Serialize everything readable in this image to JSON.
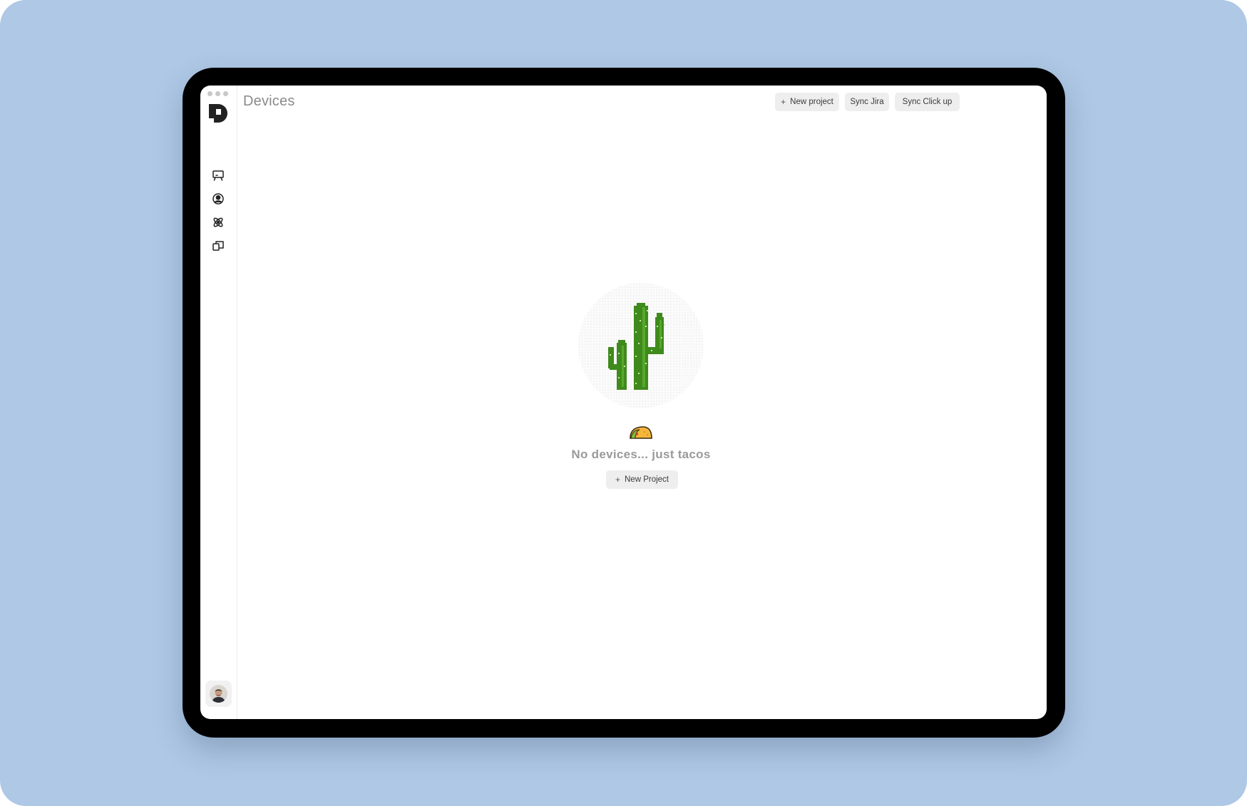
{
  "header": {
    "title": "Devices",
    "buttons": {
      "new_project": {
        "icon": "plus-icon",
        "label": "New project"
      },
      "sync_jira": {
        "label": "Sync Jira"
      },
      "sync_clickup": {
        "label": "Sync Click up"
      }
    }
  },
  "sidebar": {
    "logo": "app-logo",
    "items": [
      {
        "icon": "presentation-screen-icon"
      },
      {
        "icon": "user-circle-icon"
      },
      {
        "icon": "atom-icon"
      },
      {
        "icon": "copy-windows-icon"
      }
    ],
    "avatar": "user-avatar"
  },
  "empty_state": {
    "illustration": "cactus-pixel-art",
    "emoji": "taco-icon",
    "message": "No devices... just tacos",
    "button": {
      "icon": "plus-icon",
      "label": "New Project"
    }
  },
  "colors": {
    "background": "#aec8e5",
    "frame": "#000000",
    "button_bg": "#eeeeee",
    "cactus_green": "#3f8a1c"
  }
}
